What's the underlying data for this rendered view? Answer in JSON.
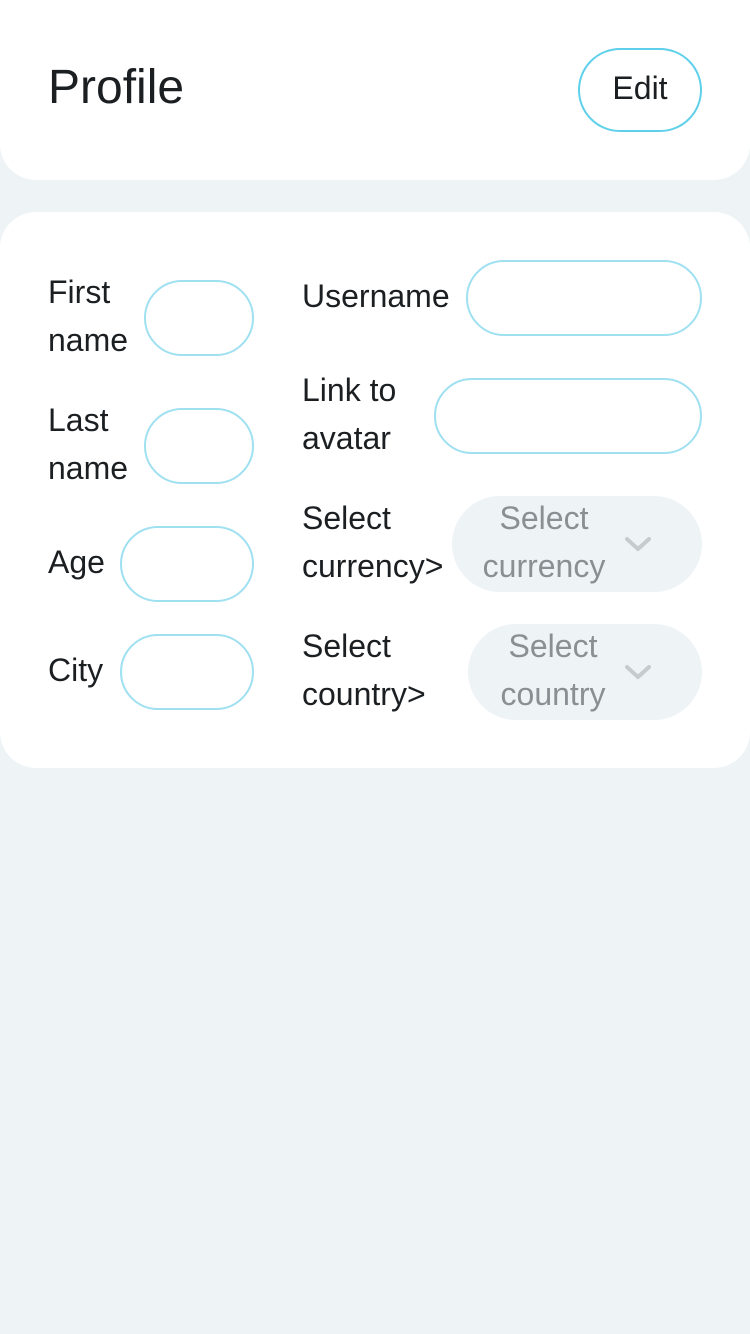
{
  "header": {
    "title": "Profile",
    "edit_label": "Edit"
  },
  "form": {
    "first_name": {
      "label_line1": "First",
      "label_line2": "name",
      "value": ""
    },
    "last_name": {
      "label_line1": "Last",
      "label_line2": "name",
      "value": ""
    },
    "age": {
      "label": "Age",
      "value": ""
    },
    "city": {
      "label": "City",
      "value": ""
    },
    "username": {
      "label": "Username",
      "value": ""
    },
    "avatar_link": {
      "label_line1": "Link to",
      "label_line2": "avatar",
      "value": ""
    },
    "currency": {
      "label_line1": "Select",
      "label_line2": "currency>",
      "placeholder_line1": "Select",
      "placeholder_line2": "currency"
    },
    "country": {
      "label_line1": "Select",
      "label_line2": "country>",
      "placeholder_line1": "Select",
      "placeholder_line2": "country"
    }
  },
  "colors": {
    "accent": "#5fd0ea",
    "input_border": "#9fe0f1",
    "background": "#eef3f6",
    "placeholder": "#8a8f93"
  },
  "icons": {
    "select_chevron": "chevron-down-icon"
  }
}
